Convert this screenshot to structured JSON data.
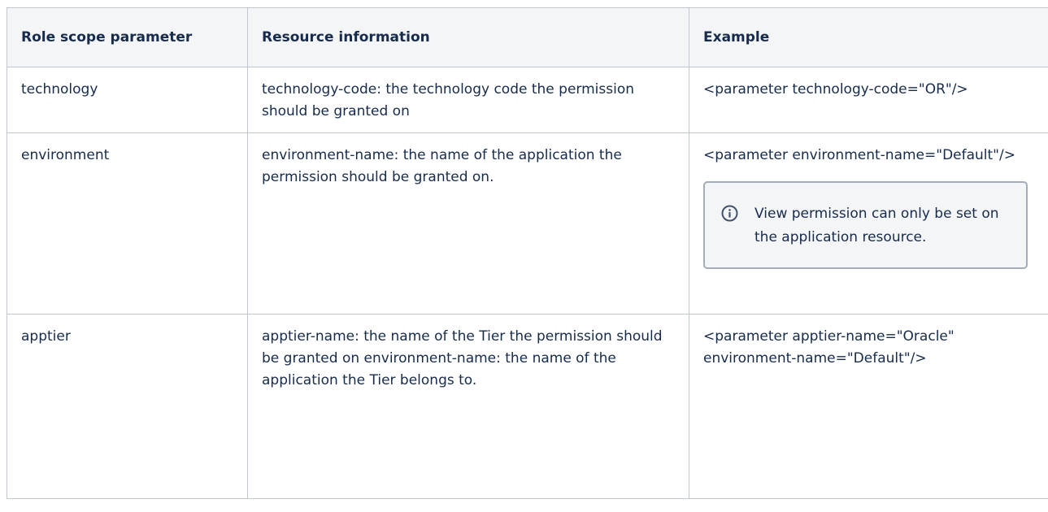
{
  "table": {
    "headers": [
      "Role scope parameter",
      "Resource information",
      "Example"
    ],
    "rows": [
      {
        "parameter": "technology",
        "info": "technology-code: the technology code the permission should be granted on",
        "example": "<parameter technology-code=\"OR\"/>"
      },
      {
        "parameter": "environment",
        "info": "environment-name: the name of the application the permission should be granted on.",
        "example": "<parameter environment-name=\"Default\"/>",
        "note": "View permission can only be set on the application resource."
      },
      {
        "parameter": "apptier",
        "info": "apptier-name: the name of the Tier the permission should be granted on environment-name: the name of the application the Tier belongs to.",
        "example": "<parameter apptier-name=\"Oracle\" environment-name=\"Default\"/>"
      }
    ]
  },
  "icons": {
    "note_icon": "info-icon"
  },
  "colors": {
    "header_bg": "#f4f5f7",
    "border": "#c1c7d0",
    "panel_border": "#a5adba",
    "icon": "#42526e"
  }
}
